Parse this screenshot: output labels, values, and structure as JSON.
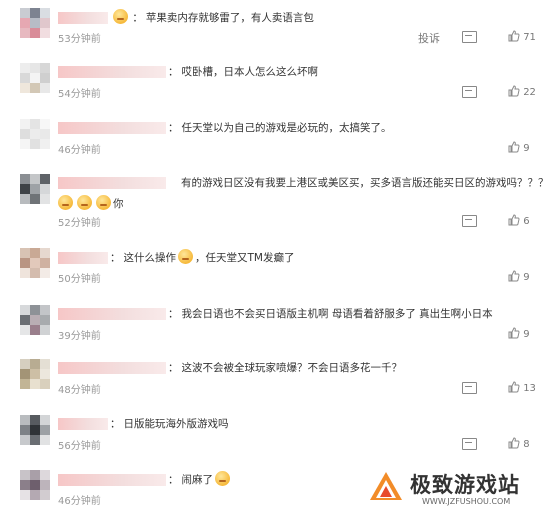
{
  "actions": {
    "report_label": "投诉"
  },
  "comments": [
    {
      "text": "苹果卖内存就够雷了，有人卖语言包",
      "time": "53分钟前",
      "likes": "71",
      "has_emoji_prefix": true
    },
    {
      "text": "哎卧槽，日本人怎么这么坏啊",
      "time": "54分钟前",
      "likes": "22"
    },
    {
      "text": "任天堂以为自己的游戏是必玩的，太搞笑了。",
      "time": "46分钟前",
      "likes": "9"
    },
    {
      "text": "有的游戏日区没有我要上港区或美区买，买多语言版还能买日区的游戏吗？？？",
      "text2": "你",
      "time": "52分钟前",
      "likes": "6"
    },
    {
      "text": "这什么操作",
      "text_after_emoji": "，任天堂又TM发癫了",
      "time": "50分钟前",
      "likes": "9"
    },
    {
      "text": "我会日语也不会买日语版主机啊 母语看着舒服多了 真出生啊小日本",
      "time": "39分钟前",
      "likes": "9"
    },
    {
      "text": "这波不会被全球玩家喷爆？不会日语多花一千？",
      "time": "48分钟前",
      "likes": "13"
    },
    {
      "text": "日版能玩海外版游戏吗",
      "time": "56分钟前",
      "likes": "8"
    },
    {
      "text": "闹麻了",
      "time": "46分钟前",
      "likes": ""
    }
  ],
  "watermark": {
    "title": "极致游戏站",
    "url": "WWW.JZFUSHOU.COM"
  }
}
